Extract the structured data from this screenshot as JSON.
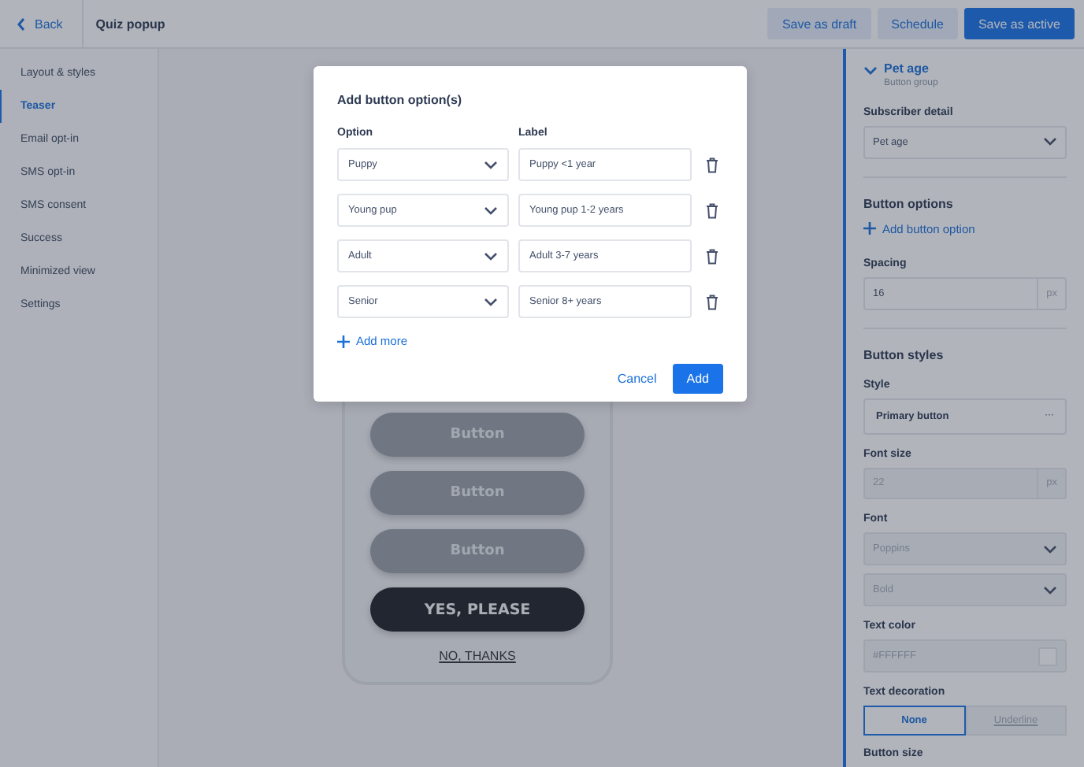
{
  "topbar": {
    "back": "Back",
    "title": "Quiz popup",
    "actions": [
      {
        "label": "Save as draft",
        "kind": "secondary"
      },
      {
        "label": "Schedule",
        "kind": "secondary"
      },
      {
        "label": "Save as active",
        "kind": "primary"
      }
    ]
  },
  "sidebar": {
    "items": [
      {
        "label": "Layout & styles",
        "selected": false
      },
      {
        "label": "Teaser",
        "selected": true
      },
      {
        "label": "Email opt-in",
        "selected": false
      },
      {
        "label": "SMS opt-in",
        "selected": false
      },
      {
        "label": "SMS consent",
        "selected": false
      },
      {
        "label": "Success",
        "selected": false
      },
      {
        "label": "Minimized view",
        "selected": false
      },
      {
        "label": "Settings",
        "selected": false
      }
    ]
  },
  "preview": {
    "buttons": [
      {
        "label": "Button",
        "kind": "secondary"
      },
      {
        "label": "Button",
        "kind": "secondary"
      },
      {
        "label": "Button",
        "kind": "secondary"
      },
      {
        "label": "YES, PLEASE",
        "kind": "primary"
      }
    ],
    "link": "NO, THANKS"
  },
  "panel": {
    "title": "Pet age",
    "subtitle": "Button group",
    "expanded": true,
    "subscriber_detail": {
      "label": "Subscriber detail",
      "value": "Pet age"
    },
    "button_options": {
      "heading": "Button options",
      "add": "Add button option"
    },
    "spacing": {
      "label": "Spacing",
      "value": "16",
      "unit": "px"
    },
    "button_styles": {
      "heading": "Button styles",
      "fields": [
        {
          "kind": "menu",
          "label": "Style",
          "value": "Primary button",
          "menu": "···",
          "disabled": false
        },
        {
          "kind": "number",
          "label": "Font size",
          "value": "22",
          "unit": "px",
          "disabled": true
        },
        {
          "kind": "select",
          "label": "Font",
          "value": "Poppins",
          "disabled": true
        },
        {
          "kind": "select",
          "value": "Bold",
          "disabled": true
        },
        {
          "kind": "color",
          "label": "Text color",
          "value": "#FFFFFF",
          "disabled": true
        }
      ]
    },
    "text_decoration": {
      "label": "Text decoration",
      "options": [
        {
          "label": "None",
          "selected": true
        },
        {
          "label": "Underline",
          "selected": false
        }
      ]
    },
    "button_size": {
      "label": "Button size"
    }
  },
  "dialog": {
    "title": "Add button option(s)",
    "columns": [
      "Option",
      "Label"
    ],
    "rows": [
      {
        "option": "Puppy",
        "label": "Puppy <1 year"
      },
      {
        "option": "Young pup",
        "label": "Young pup 1-2 years"
      },
      {
        "option": "Adult",
        "label": "Adult 3-7 years"
      },
      {
        "option": "Senior",
        "label": "Senior 8+ years"
      }
    ],
    "add_more": "Add more",
    "cancel": "Cancel",
    "confirm": "Add"
  }
}
